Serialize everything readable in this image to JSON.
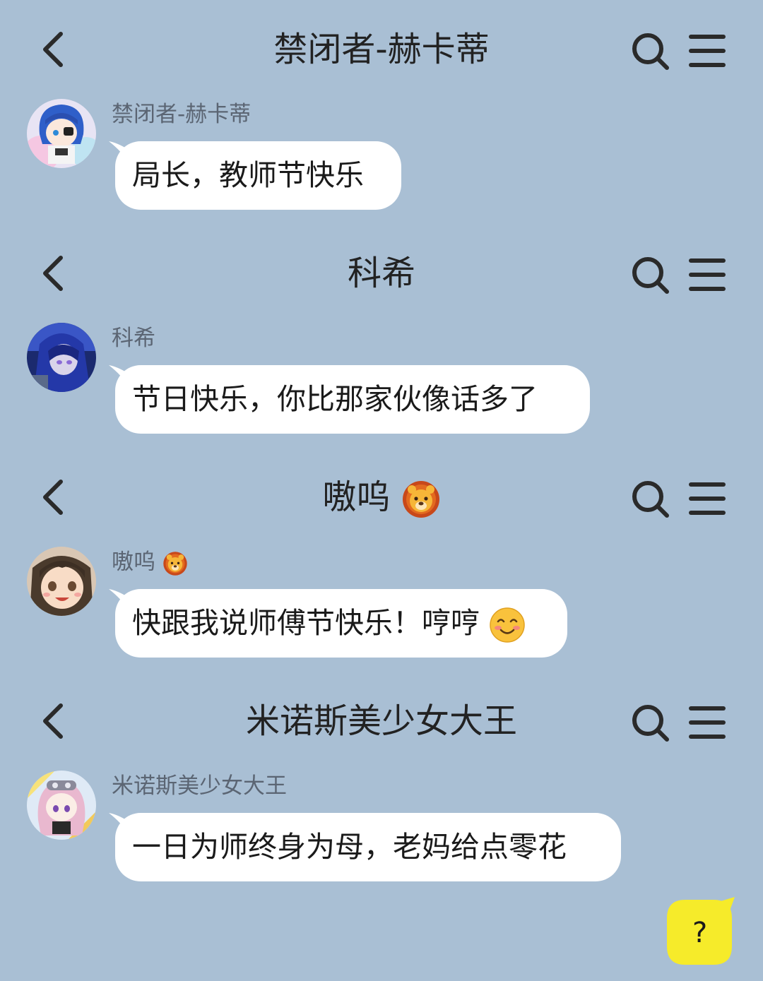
{
  "chats": [
    {
      "header_title": "禁闭者-赫卡蒂",
      "sender": "禁闭者-赫卡蒂",
      "message": "局长，教师节快乐",
      "avatar": "chibi-blue-hair-avatar"
    },
    {
      "header_title": "科希",
      "sender": "科希",
      "message": "节日快乐，你比那家伙像话多了",
      "avatar": "dark-blue-hair-avatar"
    },
    {
      "header_title": "嗷呜",
      "sender": "嗷呜",
      "message": "快跟我说师傅节快乐！哼哼",
      "avatar": "brown-hair-avatar",
      "title_emoji": "lion-face-icon",
      "message_emoji": "smiling-face-icon"
    },
    {
      "header_title": "米诺斯美少女大王",
      "sender": "米诺斯美少女大王",
      "message": "一日为师终身为母，老妈给点零花",
      "avatar": "chibi-pink-hair-avatar"
    }
  ],
  "icons": {
    "back": "chevron-left-icon",
    "search": "search-icon",
    "menu": "menu-icon",
    "help": "help-bubble-icon"
  },
  "help_button": {
    "label": "?"
  },
  "colors": {
    "background": "#a9bfd4",
    "bubble": "#ffffff",
    "help": "#f6eb2a",
    "text": "#222222",
    "sender": "#5b6573"
  }
}
